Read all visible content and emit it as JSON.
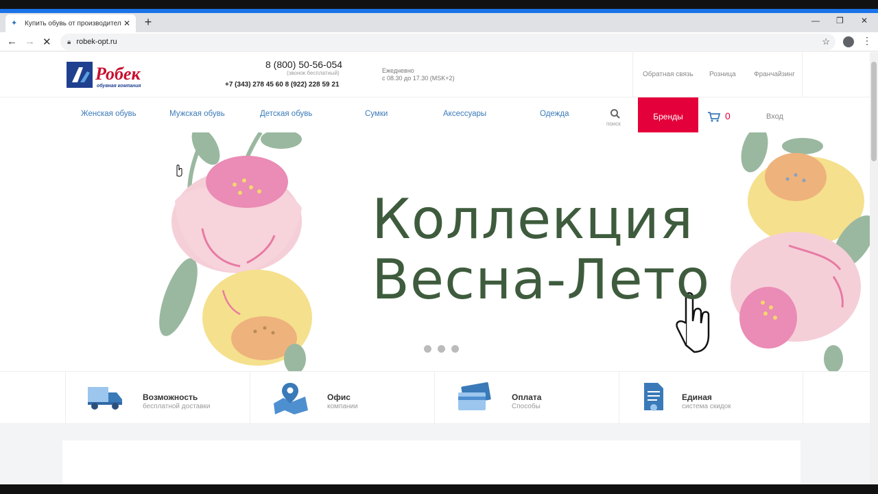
{
  "browser": {
    "tab_title": "Купить обувь от производителя",
    "url": "robek-opt.ru"
  },
  "header": {
    "phone_main": "8 (800) 50-56-054",
    "phone_free": "(звонок бесплатный)",
    "phone_more": "+7 (343) 278 45 60  8 (922) 228 59 21",
    "hours_line1": "Ежедневно",
    "hours_line2": "с 08.30 до 17.30 (MSK+2)",
    "links": [
      "Обратная связь",
      "Розница",
      "Франчайзинг"
    ]
  },
  "menu": {
    "items": [
      "Женская обувь",
      "Мужская обувь",
      "Детская обувь",
      "Сумки",
      "Аксессуары",
      "Одежда"
    ],
    "search_label": "поиск",
    "brands_label": "Бренды",
    "cart_count": "0",
    "login_label": "Вход"
  },
  "hero": {
    "line1": "Коллекция",
    "line2": "Весна-Лето",
    "slides_count": 3
  },
  "features": [
    {
      "title": "Возможность",
      "subtitle": "бесплатной доставки",
      "icon": "delivery-truck-icon"
    },
    {
      "title": "Офис",
      "subtitle": "компании",
      "icon": "map-pin-icon"
    },
    {
      "title": "Оплата",
      "subtitle": "Способы",
      "icon": "credit-card-icon"
    },
    {
      "title": "Единая",
      "subtitle": "система скидок",
      "icon": "document-icon"
    }
  ]
}
